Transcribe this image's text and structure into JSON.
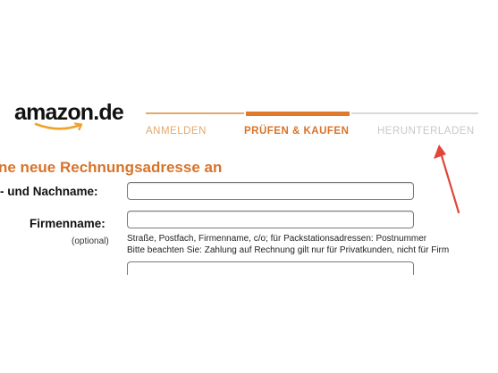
{
  "logo": {
    "brand": "amazon.de",
    "name": "amazon-logo"
  },
  "steps": [
    {
      "label": "ANMELDEN",
      "state": "done"
    },
    {
      "label": "PRÜFEN & KAUFEN",
      "state": "active"
    },
    {
      "label": "HERUNTERLADEN",
      "state": "future"
    }
  ],
  "form": {
    "heading": "ne neue Rechnungsadresse an",
    "name_label": "- und Nachname:",
    "name_value": "",
    "company_label": "Firmenname:",
    "company_optional": "(optional)",
    "company_value": "",
    "street_hint_1": "Straße, Postfach, Firmenname, c/o; für Packstationsadressen: Postnummer",
    "street_hint_2": "Bitte beachten Sie: Zahlung auf Rechnung gilt nur für Privatkunden, nicht für Firm"
  },
  "colors": {
    "accent": "#d8732a",
    "step_done": "#e4a86b",
    "step_future": "#c8c8c8",
    "arrow": "#e0463a"
  }
}
